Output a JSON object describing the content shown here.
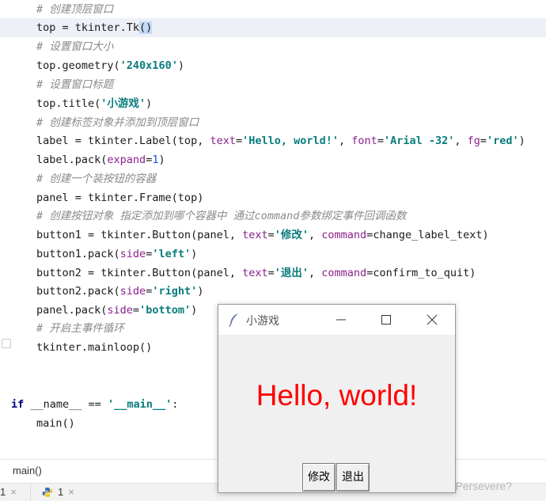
{
  "editor": {
    "lines": [
      {
        "comment": "# 创建顶层窗口"
      },
      {
        "a": "top = tkinter.Tk",
        "sel": "()"
      },
      {
        "comment": "# 设置窗口大小"
      },
      {
        "a": "top.geometry(",
        "s": "'240x160'",
        "b": ")"
      },
      {
        "comment": "# 设置窗口标题"
      },
      {
        "a": "top.title(",
        "s": "'小游戏'",
        "b": ")"
      },
      {
        "comment": "# 创建标签对象并添加到顶层窗口"
      },
      {
        "a": "label = tkinter.Label(top, ",
        "p1": "text",
        "e1": "=",
        "s1": "'Hello, world!'",
        "c1": ", ",
        "p2": "font",
        "e2": "=",
        "s2": "'Arial -32'",
        "c2": ", ",
        "p3": "fg",
        "e3": "=",
        "s3": "'red'",
        "b": ")"
      },
      {
        "a": "label.pack(",
        "p1": "expand",
        "e1": "=",
        "n1": "1",
        "b": ")"
      },
      {
        "comment": "# 创建一个装按钮的容器"
      },
      {
        "a": "panel = tkinter.Frame(top)"
      },
      {
        "comment1": "# 创建按钮对象 指定添加到哪个容器中 通过",
        "cmd": "command",
        "comment2": "参数绑定事件回调函数"
      },
      {
        "a": "button1 = tkinter.Button(panel, ",
        "p1": "text",
        "e1": "=",
        "s1": "'修改'",
        "c1": ", ",
        "p2": "command",
        "e2": "=",
        "v2": "change_label_text",
        "b": ")"
      },
      {
        "a": "button1.pack(",
        "p1": "side",
        "e1": "=",
        "s1": "'left'",
        "b": ")"
      },
      {
        "a": "button2 = tkinter.Button(panel, ",
        "p1": "text",
        "e1": "=",
        "s1": "'退出'",
        "c1": ", ",
        "p2": "command",
        "e2": "=",
        "v2": "confirm_to_quit",
        "b": ")"
      },
      {
        "a": "button2.pack(",
        "p1": "side",
        "e1": "=",
        "s1": "'right'",
        "b": ")"
      },
      {
        "a": "panel.pack(",
        "p1": "side",
        "e1": "=",
        "s1": "'bottom'",
        "b": ")"
      },
      {
        "comment": "# 开启主事件循环"
      },
      {
        "a": "tkinter.mainloop()"
      },
      {
        "kw": "if",
        "a": " __name__ == ",
        "s": "'__main__'",
        "b": ":"
      },
      {
        "a": "main()"
      }
    ]
  },
  "breadcrumb": "main()",
  "tabs": [
    {
      "label": "1",
      "close": "×"
    },
    {
      "label": "1",
      "close": "×"
    }
  ],
  "watermark": "CSDN @? Persevere?",
  "tk_window": {
    "title": "小游戏",
    "label_text": "Hello, world!",
    "label_color": "#ff0000",
    "buttons": [
      "修改",
      "退出"
    ]
  }
}
